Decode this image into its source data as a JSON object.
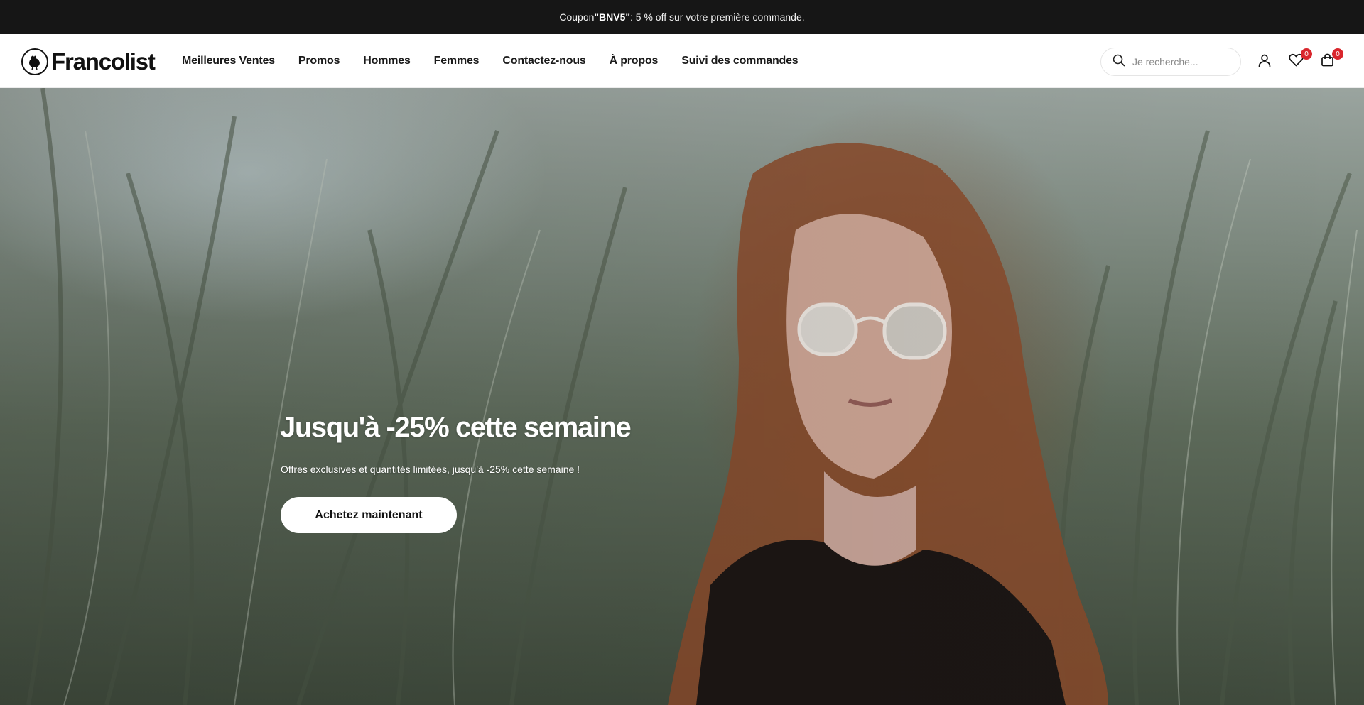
{
  "announcement": {
    "prefix": "Coupon ",
    "code": "\"BNV5\"",
    "suffix": " : 5 % off sur votre première commande."
  },
  "header": {
    "logo_text": "Francolist",
    "nav": [
      {
        "label": "Meilleures Ventes"
      },
      {
        "label": "Promos"
      },
      {
        "label": "Hommes"
      },
      {
        "label": "Femmes"
      },
      {
        "label": "Contactez-nous"
      },
      {
        "label": "À propos"
      },
      {
        "label": "Suivi des commandes"
      }
    ],
    "search": {
      "placeholder": "Je recherche..."
    },
    "wishlist_count": "0",
    "cart_count": "0"
  },
  "hero": {
    "title": "Jusqu'à -25% cette semaine",
    "subtitle": "Offres exclusives et quantités limitées, jusqu'à -25% cette semaine !",
    "cta_label": "Achetez maintenant"
  },
  "colors": {
    "announcement_bg": "#161616",
    "badge": "#d9262c",
    "header_bg": "#ffffff"
  }
}
